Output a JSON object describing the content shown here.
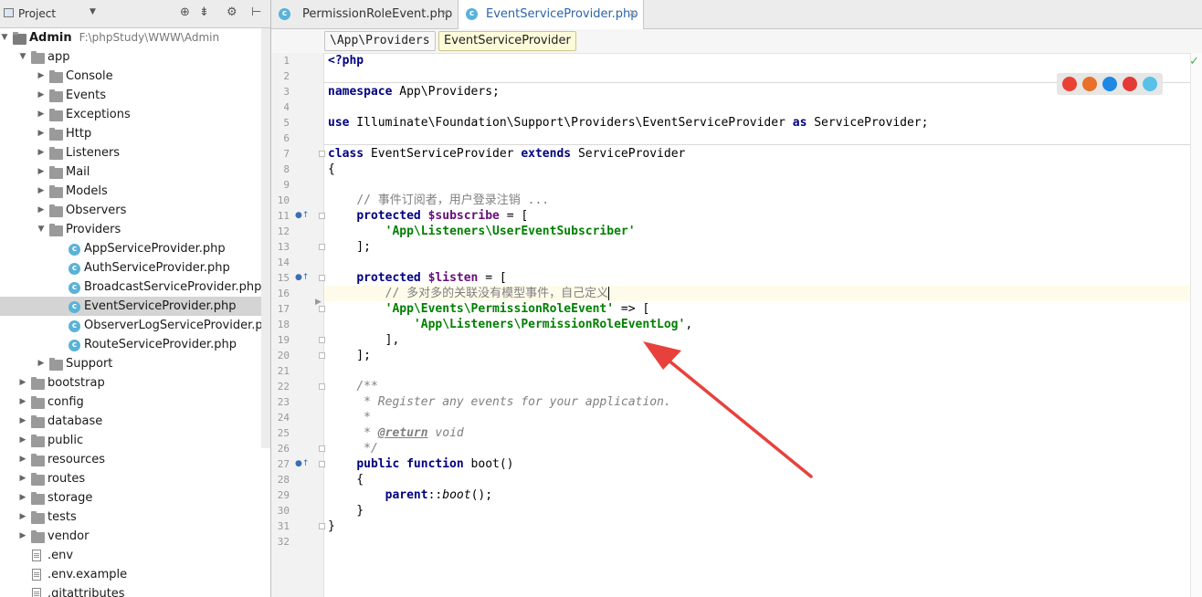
{
  "project_panel": {
    "title": "Project",
    "dropdown_glyph": "▼",
    "toolbar_icons": [
      "target-icon",
      "collapse-icon",
      "gear-icon",
      "hide-icon"
    ],
    "tree": [
      {
        "label": "Admin",
        "path": "F:\\phpStudy\\WWW\\Admin",
        "kind": "folder",
        "bold": true,
        "expanded": true
      },
      {
        "label": "app",
        "kind": "folder",
        "expanded": true
      },
      {
        "label": "Console",
        "kind": "folder"
      },
      {
        "label": "Events",
        "kind": "folder"
      },
      {
        "label": "Exceptions",
        "kind": "folder"
      },
      {
        "label": "Http",
        "kind": "folder"
      },
      {
        "label": "Listeners",
        "kind": "folder"
      },
      {
        "label": "Mail",
        "kind": "folder"
      },
      {
        "label": "Models",
        "kind": "folder"
      },
      {
        "label": "Observers",
        "kind": "folder"
      },
      {
        "label": "Providers",
        "kind": "folder",
        "expanded": true
      },
      {
        "label": "AppServiceProvider.php",
        "kind": "class"
      },
      {
        "label": "AuthServiceProvider.php",
        "kind": "class"
      },
      {
        "label": "BroadcastServiceProvider.php",
        "kind": "class"
      },
      {
        "label": "EventServiceProvider.php",
        "kind": "class",
        "selected": true
      },
      {
        "label": "ObserverLogServiceProvider.php",
        "kind": "class"
      },
      {
        "label": "RouteServiceProvider.php",
        "kind": "class"
      },
      {
        "label": "Support",
        "kind": "folder"
      },
      {
        "label": "bootstrap",
        "kind": "folder"
      },
      {
        "label": "config",
        "kind": "folder"
      },
      {
        "label": "database",
        "kind": "folder"
      },
      {
        "label": "public",
        "kind": "folder"
      },
      {
        "label": "resources",
        "kind": "folder"
      },
      {
        "label": "routes",
        "kind": "folder"
      },
      {
        "label": "storage",
        "kind": "folder"
      },
      {
        "label": "tests",
        "kind": "folder"
      },
      {
        "label": "vendor",
        "kind": "folder"
      },
      {
        "label": ".env",
        "kind": "file"
      },
      {
        "label": ".env.example",
        "kind": "file"
      },
      {
        "label": ".gitattributes",
        "kind": "file"
      }
    ]
  },
  "tabs": [
    {
      "label": "PermissionRoleEvent.php",
      "icon": "c",
      "active": false,
      "close": "✕"
    },
    {
      "label": "EventServiceProvider.php",
      "icon": "c",
      "active": true,
      "close": "✕"
    }
  ],
  "breadcrumbs": [
    "\\App\\Providers",
    "EventServiceProvider"
  ],
  "code": {
    "line_count": 32,
    "overrides_at": [
      11,
      15,
      27
    ],
    "folds_at": [
      7,
      11,
      13,
      15,
      17,
      19,
      20,
      22,
      26,
      27,
      31
    ],
    "caret_line": 16
  },
  "status": {
    "check": "✓"
  },
  "browsers": [
    {
      "name": "chrome",
      "color": "#e94235"
    },
    {
      "name": "firefox",
      "color": "#e8702a"
    },
    {
      "name": "safari",
      "color": "#1e88e5"
    },
    {
      "name": "opera",
      "color": "#e53935"
    },
    {
      "name": "ie",
      "color": "#57c1e8"
    }
  ],
  "annotation_color": "#e8413c"
}
